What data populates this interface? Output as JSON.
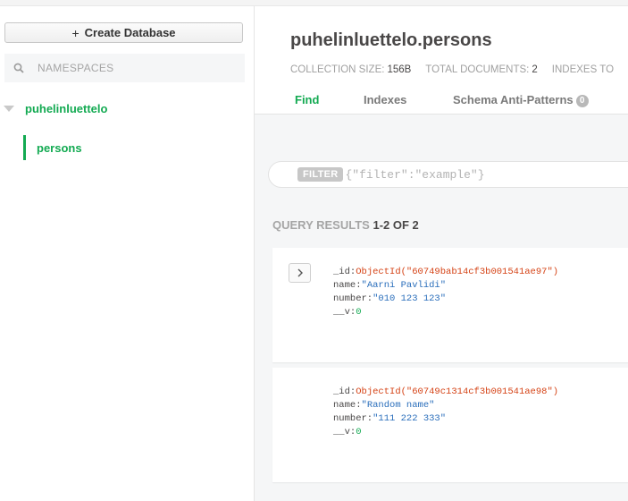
{
  "sidebar": {
    "create_button": "Create Database",
    "create_icon": "plus-icon",
    "search_placeholder": "NAMESPACES",
    "database": "puhelinluettelo",
    "collection": "persons"
  },
  "header": {
    "title": "puhelinluettelo.persons",
    "stats": [
      {
        "label": "COLLECTION SIZE:",
        "value": "156B"
      },
      {
        "label": "TOTAL DOCUMENTS:",
        "value": "2"
      },
      {
        "label": "INDEXES TO",
        "value": ""
      }
    ],
    "tabs": [
      {
        "label": "Find"
      },
      {
        "label": "Indexes"
      },
      {
        "label": "Schema Anti-Patterns",
        "badge": "0"
      }
    ]
  },
  "filter": {
    "label": "FILTER",
    "placeholder": "{\"filter\":\"example\"}"
  },
  "results": {
    "label": "QUERY RESULTS",
    "count": "1-2 OF 2"
  },
  "documents": [
    {
      "id_key": "_id:",
      "id": "ObjectId(\"60749bab14cf3b001541ae97\")",
      "name_key": "name:",
      "name": "\"Aarni Pavlidi\"",
      "number_key": "number:",
      "number": "\"010 123 123\"",
      "v_key": "__v:",
      "v": "0"
    },
    {
      "id_key": "_id:",
      "id": "ObjectId(\"60749c1314cf3b001541ae98\")",
      "name_key": "name:",
      "name": "\"Random name\"",
      "number_key": "number:",
      "number": "\"111 222 333\"",
      "v_key": "__v:",
      "v": "0"
    }
  ],
  "colors": {
    "accent": "#13aa52",
    "object_id": "#d54316",
    "string": "#2a6ebb"
  }
}
